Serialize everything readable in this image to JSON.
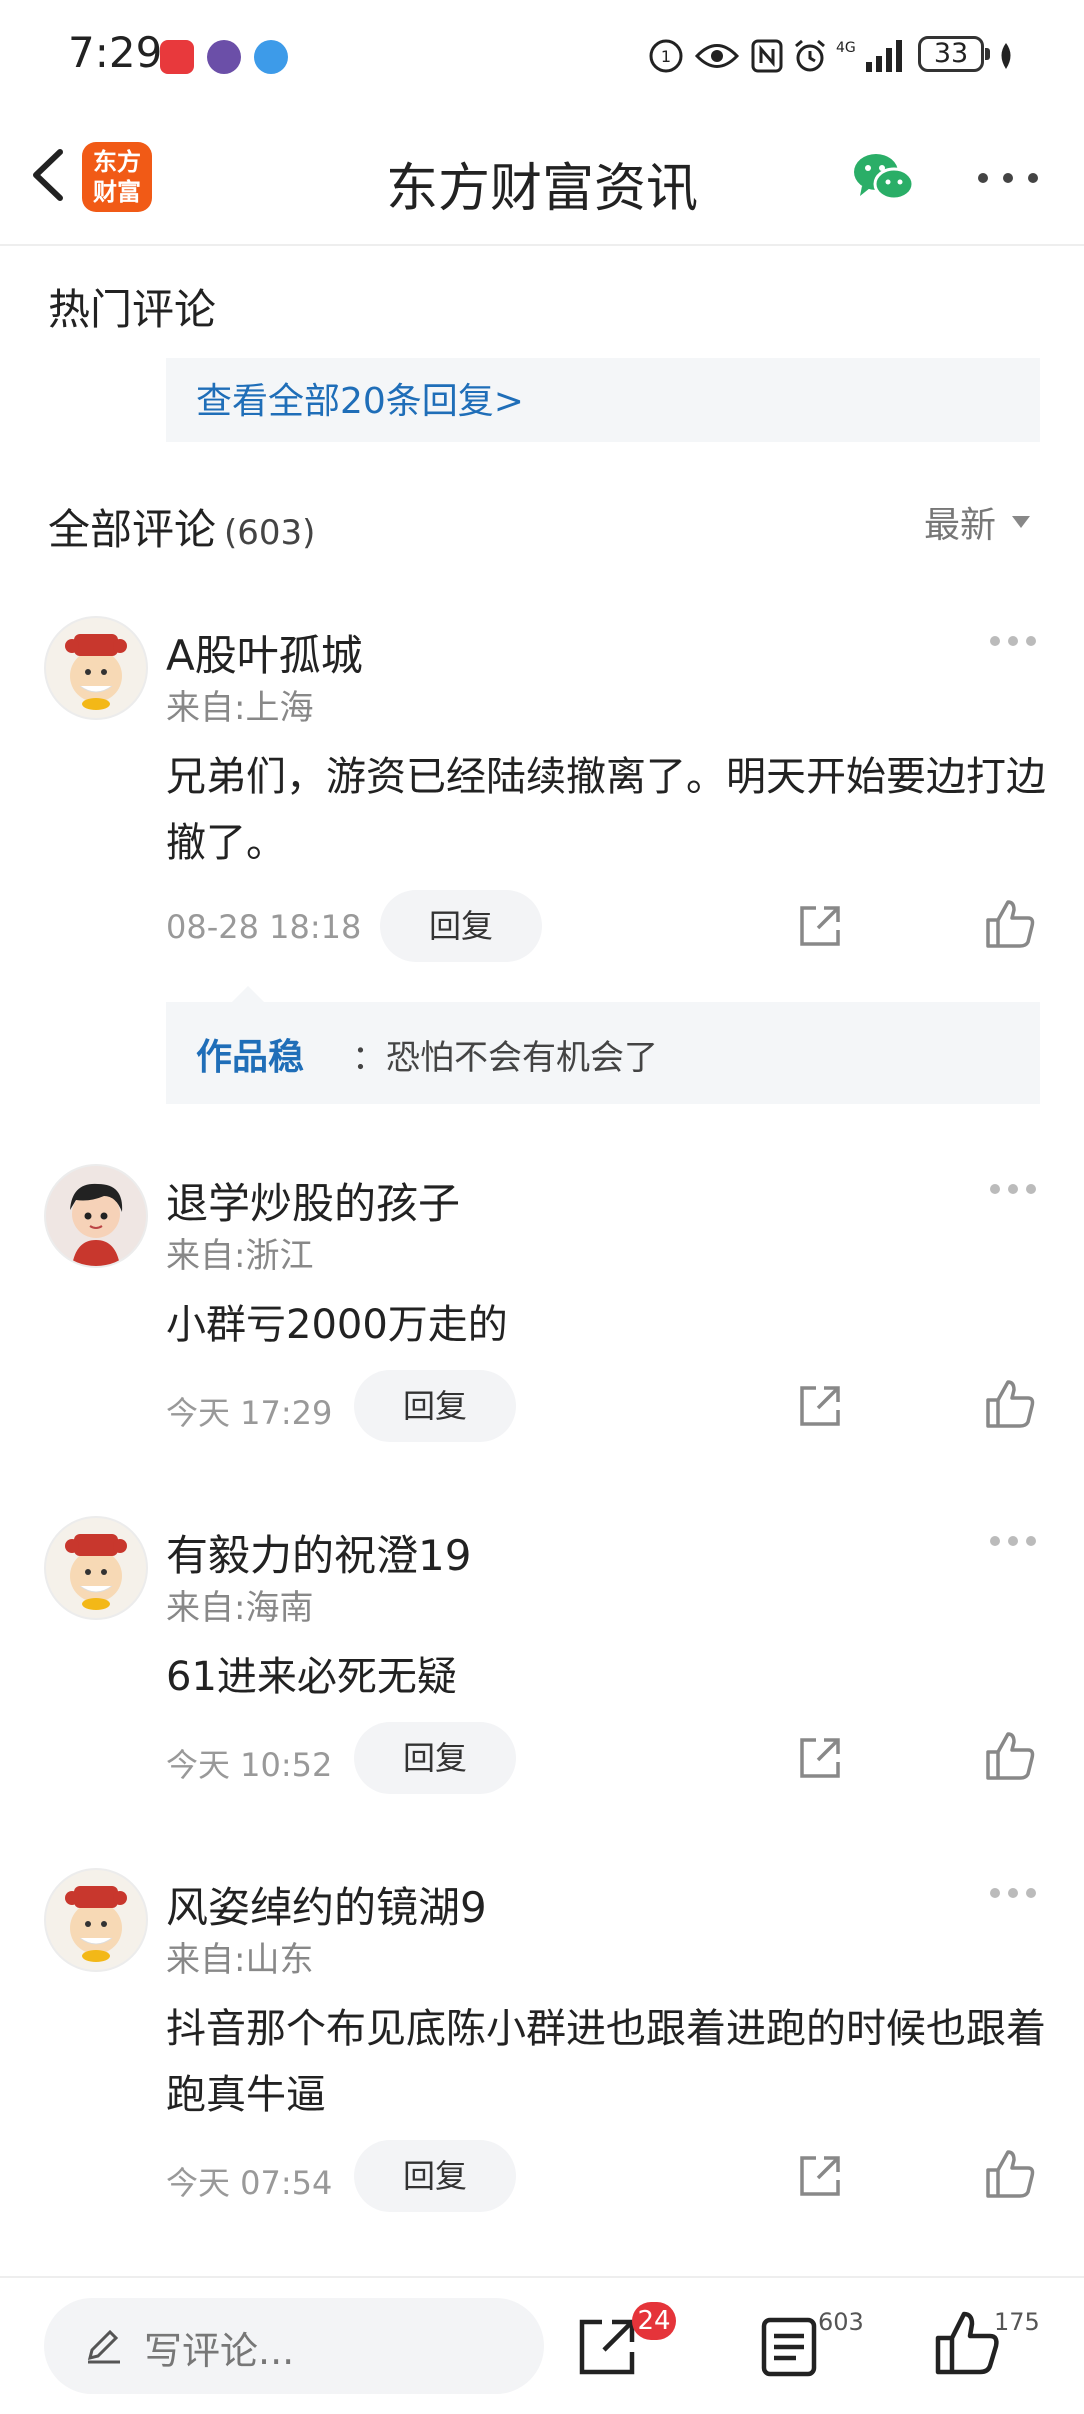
{
  "status_bar": {
    "time": "7:29",
    "network": "4G",
    "battery": "33"
  },
  "header": {
    "logo_text_line1": "东方",
    "logo_text_line2": "财富",
    "title": "东方财富资讯"
  },
  "hot_comments": {
    "title": "热门评论",
    "view_all": "查看全部20条回复>"
  },
  "all_comments": {
    "title": "全部评论",
    "count": "(603)",
    "sort": "最新"
  },
  "comments": [
    {
      "username": "A股叶孤城",
      "location": "来自:上海",
      "text": "兄弟们，游资已经陆续撤离了。明天开始要边打边撤了。",
      "time": "08-28 18:18",
      "reply_label": "回复",
      "sub_reply": {
        "author": "作品稳",
        "text": "：恐怕不会有机会了"
      }
    },
    {
      "username": "退学炒股的孩子",
      "location": "来自:浙江",
      "text": "小群亏2000万走的",
      "time": "今天 17:29",
      "reply_label": "回复"
    },
    {
      "username": "有毅力的祝澄19",
      "location": "来自:海南",
      "text": "61进来必死无疑",
      "time": "今天 10:52",
      "reply_label": "回复"
    },
    {
      "username": "风姿绰约的镜湖9",
      "location": "来自:山东",
      "text": "抖音那个布见底陈小群进也跟着进跑的时候也跟着跑真牛逼",
      "time": "今天 07:54",
      "reply_label": "回复"
    }
  ],
  "bottom_bar": {
    "placeholder": "写评论...",
    "share_badge": "24",
    "comment_count": "603",
    "like_count": "175"
  },
  "colors": {
    "link_blue": "#1f6eb8",
    "brand_orange": "#f15a16",
    "wechat_green": "#2aae67",
    "badge_red": "#e5343a"
  }
}
